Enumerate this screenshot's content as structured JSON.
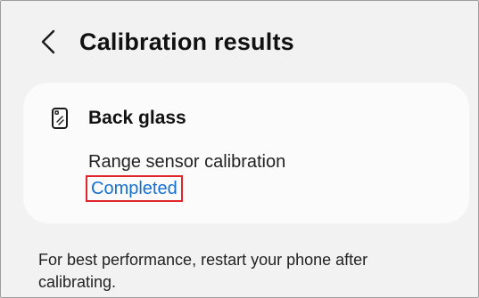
{
  "header": {
    "back_icon": "chevron-left-icon",
    "title": "Calibration results"
  },
  "card": {
    "icon": "phone-back-glass-icon",
    "title": "Back glass",
    "subtitle": "Range sensor calibration",
    "status": "Completed"
  },
  "colors": {
    "background": "#f2f2f2",
    "card": "#fbfbfb",
    "status_text": "#1670d0",
    "highlight_border": "#e0262a"
  },
  "footer": {
    "note": "For best performance, restart your phone after calibrating."
  }
}
